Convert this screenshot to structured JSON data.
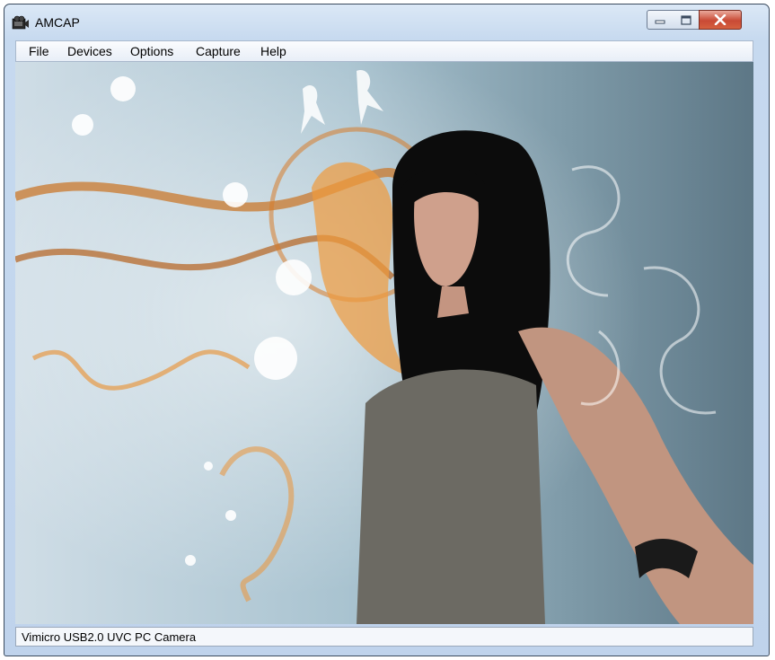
{
  "window": {
    "title": "AMCAP"
  },
  "menu": [
    "File",
    "Devices",
    "Options",
    "Capture",
    "Help"
  ],
  "status": {
    "device": "Vimicro USB2.0 UVC PC Camera"
  },
  "viewport": {
    "content": "camera-preview-image"
  }
}
